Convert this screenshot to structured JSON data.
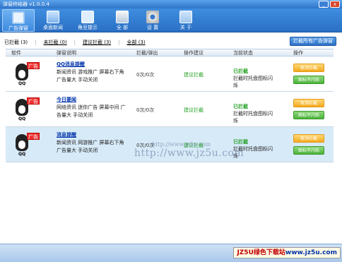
{
  "window": {
    "title": "弹窗终结器 v1.0.0.4",
    "min_label": "_",
    "close_label": "x"
  },
  "toolbar": [
    {
      "label": "广告弹窗"
    },
    {
      "label": "桌面新闻"
    },
    {
      "label": "角豆提示"
    },
    {
      "label": "全 部"
    },
    {
      "label": "设 置"
    },
    {
      "label": "关 于"
    }
  ],
  "filter": {
    "blocked": "已拦截 (3)",
    "unblocked": "未拦截 (0)",
    "suggested": "建议拦截 (3)",
    "all": "全部 (3)",
    "block_all": "拦截所有广告弹窗"
  },
  "table": {
    "headers": [
      "软件",
      "弹窗说明",
      "拦截/弹出",
      "操作建议",
      "当前状态",
      "操作"
    ],
    "rows": [
      {
        "tag": "广告",
        "product": "QQ",
        "name": "QQ消息提醒",
        "desc": "新闻资讯 游戏推广 屏幕右下角 广告量大 手动关闭",
        "count": "0次/0次",
        "advice": "建议拦截",
        "state": "已拦截",
        "state_note": "拦截时托盘图标闪烁",
        "btn1": "取消拦截",
        "btn2": "图标不闪烁"
      },
      {
        "tag": "广告",
        "product": "QQ",
        "name": "今日要闻",
        "desc": "网络资讯 迷你广告 屏幕中间 广告量大 手动关闭",
        "count": "0次/0次",
        "advice": "建议拦截",
        "state": "已拦截",
        "state_note": "拦截时托盘图标闪烁",
        "btn1": "取消拦截",
        "btn2": "图标不闪烁"
      },
      {
        "tag": "广告",
        "product": "QQ",
        "name": "消息提醒",
        "desc": "新闻资讯 网游推广 屏幕右下角 广告量大 手动关闭",
        "count": "0次/0次",
        "advice": "建议拦截",
        "state": "已拦截",
        "state_note": "拦截时托盘图标闪烁",
        "btn1": "取消拦截",
        "btn2": "图标不闪烁"
      }
    ]
  },
  "watermark": {
    "small": "http://www.jz5u.com",
    "big": "http://www.jz5u.com"
  },
  "footer": {
    "site_red": "JZ5U绿色下载站",
    "site_blue": "www.jz5u.com"
  }
}
